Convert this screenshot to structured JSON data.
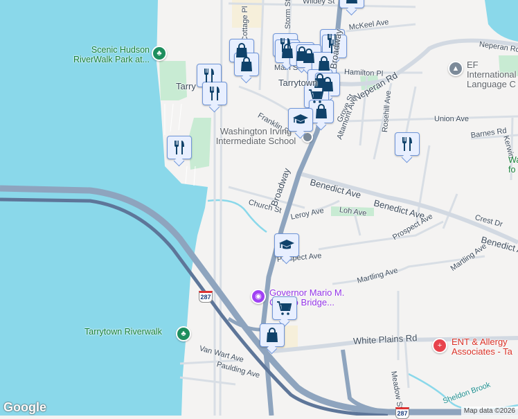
{
  "colors": {
    "water": "#8ad8ea",
    "park": "#c8ebd3",
    "highway": "#8ea4be",
    "road": "#d8dee5",
    "marker_bg": "#e8efff",
    "marker_border": "#6f95d8",
    "marker_icon": "#10426a"
  },
  "streets": {
    "wildey": "Wildey St",
    "storm": "Storm St",
    "cottage": "Cottage Pl",
    "mckeel": "McKeel Ave",
    "neperan_ave": "Neperan Rd",
    "main": "Main St",
    "hamilton": "Hamilton Pl",
    "tarrytown": "Tarrytown",
    "tarry_partial": "Tarry",
    "broadway_top": "Broadway",
    "neperan_rd": "Neperan Rd",
    "franklin": "Franklin St",
    "grove": "Grove St",
    "altamont": "Altamont Ave",
    "rosehill": "Rosehill Ave",
    "union": "Union Ave",
    "barnes": "Barnes Rd",
    "kerwin": "Kerwin",
    "benedict1": "Benedict Ave",
    "benedict2": "Benedict Ave",
    "benedict3": "Benedict Ave",
    "church": "Church St",
    "broadway": "Broadway",
    "leroy": "Leroy Ave",
    "loh": "Loh Ave",
    "crest": "Crest Dr",
    "prospect1": "Prospect Ave",
    "prospect2": "Prospect Ave",
    "martling1": "Martling Ave",
    "martling2": "Martling Ave",
    "white_plains": "White Plains Rd",
    "meadow": "Meadow St",
    "van_wart": "Van Wart Ave",
    "paulding": "Paulding Ave",
    "sheldon": "Sheldon Brook"
  },
  "pois": {
    "scenic_hudson": "Scenic Hudson RiverWalk Park at...",
    "ef": "EF International Language C",
    "washington_irving": "Washington Irving Intermediate School",
    "walter": "Walter fo",
    "cuomo": "Governor Mario M. Cuomo Bridge...",
    "tarrytown_riverwalk": "Tarrytown Riverwalk",
    "ent": "ENT & Allergy Associates - Ta"
  },
  "shields": {
    "i287_a": "287",
    "i287_b": "287"
  },
  "markers": [
    {
      "type": "shopping-bag"
    },
    {
      "type": "shopping-bag"
    },
    {
      "type": "restaurant"
    },
    {
      "type": "restaurant"
    },
    {
      "type": "restaurant"
    },
    {
      "type": "shopping-bag"
    },
    {
      "type": "shopping-bag"
    },
    {
      "type": "shopping-bag"
    },
    {
      "type": "shopping-bag"
    },
    {
      "type": "restaurant"
    },
    {
      "type": "restaurant"
    },
    {
      "type": "shopping-bag"
    },
    {
      "type": "shopping-bag"
    },
    {
      "type": "shopping-bag"
    },
    {
      "type": "grocery-cart"
    },
    {
      "type": "shopping-bag"
    },
    {
      "type": "school"
    },
    {
      "type": "restaurant"
    },
    {
      "type": "school"
    },
    {
      "type": "grocery-cart"
    },
    {
      "type": "shopping-bag"
    }
  ],
  "branding": {
    "logo": "Google",
    "attribution": "Map data ©2026"
  }
}
